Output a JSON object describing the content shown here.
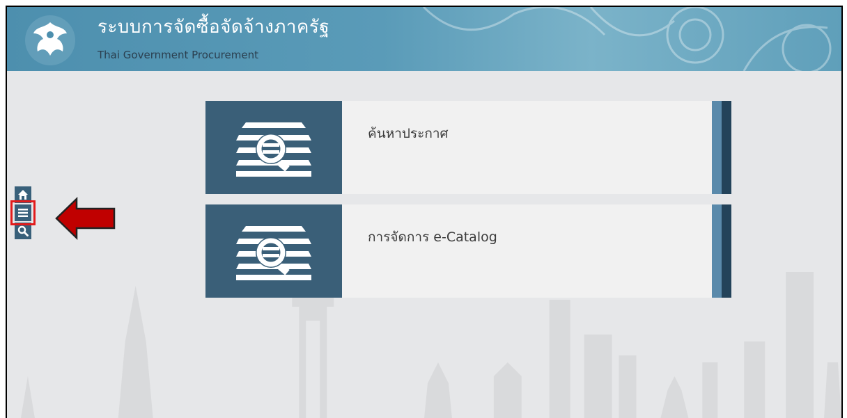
{
  "header": {
    "title": "ระบบการจัดซื้อจัดจ้างภาครัฐ",
    "subtitle": "Thai Government Procurement",
    "logo_icon": "garuda-seal-logo",
    "colors": {
      "header_bg": "#4d8fae",
      "title": "#ffffff"
    }
  },
  "sidebar": {
    "items": [
      {
        "icon": "home-icon"
      },
      {
        "icon": "menu-icon",
        "highlighted": true
      },
      {
        "icon": "search-icon"
      }
    ],
    "highlight_color": "#e21b1b",
    "pointer_arrow": "arrow-left-icon"
  },
  "cards": [
    {
      "label": "ค้นหาประกาศ",
      "icon": "document-search-icon"
    },
    {
      "label": "การจัดการ e-Catalog",
      "icon": "document-search-icon"
    }
  ],
  "colors": {
    "card_icon_bg": "#3a5f78",
    "card_bg": "#f1f1f1",
    "accent_light": "#5a8aab",
    "accent_dark": "#23435a",
    "arrow": "#c00000"
  }
}
